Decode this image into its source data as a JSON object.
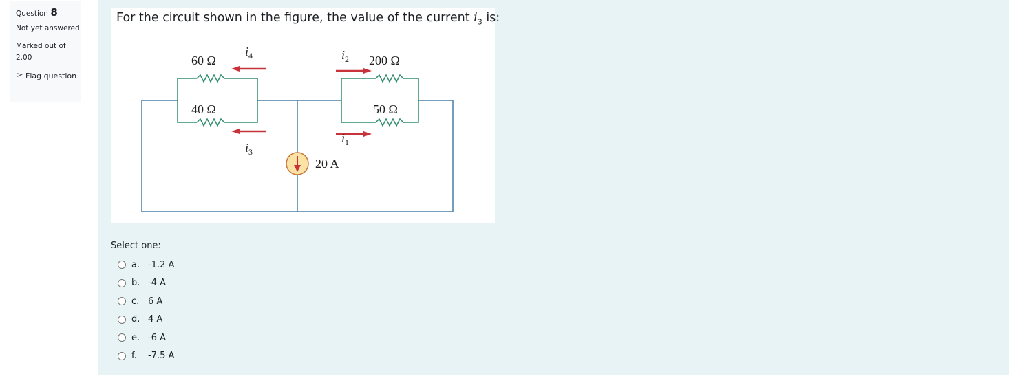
{
  "info": {
    "question_label": "Question",
    "question_number": "8",
    "state": "Not yet answered",
    "grade": "Marked out of 2.00",
    "flag_label": "Flag question",
    "flag_icon": "flag-icon"
  },
  "question": {
    "prompt_before": "For the circuit shown in the figure, the value of the current ",
    "prompt_var": "i",
    "prompt_sub": "3",
    "prompt_after": " is:"
  },
  "circuit": {
    "resistors": [
      {
        "label": "60 Ω"
      },
      {
        "label": "40 Ω"
      },
      {
        "label": "200 Ω"
      },
      {
        "label": "50 Ω"
      }
    ],
    "currents": [
      {
        "var": "i",
        "sub": "4"
      },
      {
        "var": "i",
        "sub": "3"
      },
      {
        "var": "i",
        "sub": "2"
      },
      {
        "var": "i",
        "sub": "1"
      }
    ],
    "source_label": "20 A",
    "wire_color": "#4a7fa5",
    "resistor_color": "#2e8b6e",
    "arrow_color": "#c8323a",
    "source_fill": "#fbe3a6",
    "source_stroke": "#c8783a"
  },
  "answer": {
    "select_label": "Select one:",
    "options": [
      {
        "letter": "a.",
        "text": "-1.2 A"
      },
      {
        "letter": "b.",
        "text": "-4 A"
      },
      {
        "letter": "c.",
        "text": "6 A"
      },
      {
        "letter": "d.",
        "text": "4 A"
      },
      {
        "letter": "e.",
        "text": "-6 A"
      },
      {
        "letter": "f.",
        "text": "-7.5 A"
      }
    ]
  }
}
